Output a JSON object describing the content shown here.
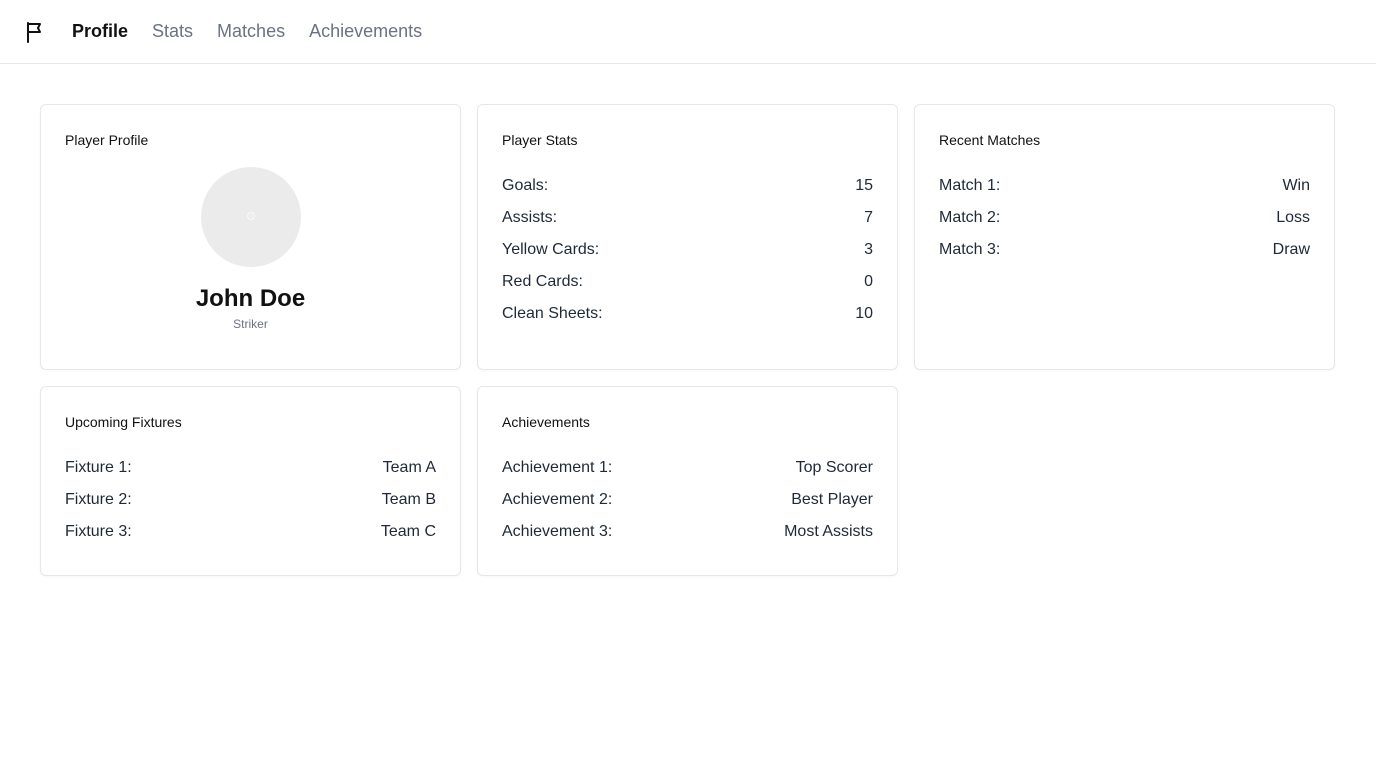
{
  "nav": {
    "logo_icon": "flag-icon",
    "tabs": [
      {
        "label": "Profile",
        "active": true
      },
      {
        "label": "Stats",
        "active": false
      },
      {
        "label": "Matches",
        "active": false
      },
      {
        "label": "Achievements",
        "active": false
      }
    ]
  },
  "profile": {
    "title": "Player Profile",
    "name": "John Doe",
    "position": "Striker",
    "avatar_icon": "avatar-placeholder-icon"
  },
  "stats": {
    "title": "Player Stats",
    "rows": [
      {
        "label": "Goals:",
        "value": "15"
      },
      {
        "label": "Assists:",
        "value": "7"
      },
      {
        "label": "Yellow Cards:",
        "value": "3"
      },
      {
        "label": "Red Cards:",
        "value": "0"
      },
      {
        "label": "Clean Sheets:",
        "value": "10"
      }
    ]
  },
  "matches": {
    "title": "Recent Matches",
    "rows": [
      {
        "label": "Match 1:",
        "value": "Win"
      },
      {
        "label": "Match 2:",
        "value": "Loss"
      },
      {
        "label": "Match 3:",
        "value": "Draw"
      }
    ]
  },
  "fixtures": {
    "title": "Upcoming Fixtures",
    "rows": [
      {
        "label": "Fixture 1:",
        "value": "Team A"
      },
      {
        "label": "Fixture 2:",
        "value": "Team B"
      },
      {
        "label": "Fixture 3:",
        "value": "Team C"
      }
    ]
  },
  "achievements": {
    "title": "Achievements",
    "rows": [
      {
        "label": "Achievement 1:",
        "value": "Top Scorer"
      },
      {
        "label": "Achievement 2:",
        "value": "Best Player"
      },
      {
        "label": "Achievement 3:",
        "value": "Most Assists"
      }
    ]
  }
}
